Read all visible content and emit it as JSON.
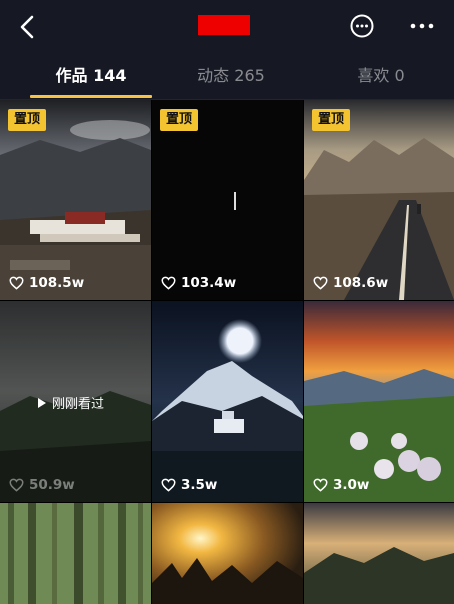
{
  "profile": {
    "tabs": [
      {
        "label": "作品 144",
        "active": true
      },
      {
        "label": "动态 265",
        "active": false
      },
      {
        "label": "喜欢 0",
        "active": false
      }
    ]
  },
  "accent_color": "#f6c344",
  "icons": {
    "back": "back-arrow-icon",
    "chat": "chat-bubble-icon",
    "more": "more-icon",
    "like": "heart-icon",
    "play": "play-icon"
  },
  "videos": [
    {
      "pinned_label": "置顶",
      "likes": "108.5w"
    },
    {
      "pinned_label": "置顶",
      "likes": "103.4w"
    },
    {
      "pinned_label": "置顶",
      "likes": "108.6w"
    },
    {
      "likes": "50.9w",
      "watched_label": "刚刚看过"
    },
    {
      "likes": "3.5w"
    },
    {
      "likes": "3.0w"
    },
    {},
    {},
    {}
  ]
}
